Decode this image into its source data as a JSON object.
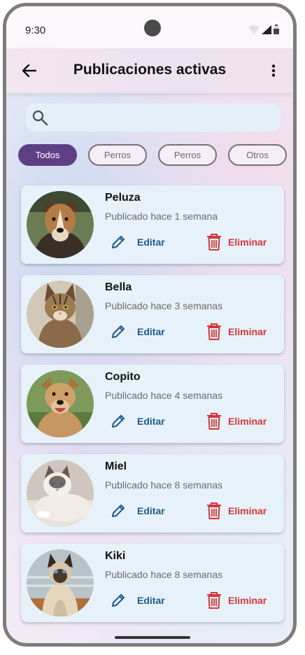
{
  "status_bar": {
    "time": "9:30"
  },
  "app_bar": {
    "title": "Publicaciones activas"
  },
  "search": {
    "value": "",
    "placeholder": ""
  },
  "filters": [
    {
      "label": "Todos",
      "active": true
    },
    {
      "label": "Perros",
      "active": false
    },
    {
      "label": "Perros",
      "active": false
    },
    {
      "label": "Otros",
      "active": false
    }
  ],
  "actions": {
    "edit_label": "Editar",
    "delete_label": "Eliminar"
  },
  "posts": [
    {
      "name": "Peluza",
      "date": "Publicado hace 1 semana",
      "photo": "dog-photo"
    },
    {
      "name": "Bella",
      "date": "Publicado hace 3 semanas",
      "photo": "cat-photo"
    },
    {
      "name": "Copito",
      "date": "Publicado hace 4 semanas",
      "photo": "dog-photo"
    },
    {
      "name": "Miel",
      "date": "Publicado hace 8 semanas",
      "photo": "cat-photo"
    },
    {
      "name": "Kiki",
      "date": "Publicado hace 8 semanas",
      "photo": "cat-photo"
    }
  ],
  "colors": {
    "accent": "#5e3f86",
    "edit": "#1e5a8c",
    "delete": "#d3373a",
    "card": "#e7f1f9"
  }
}
